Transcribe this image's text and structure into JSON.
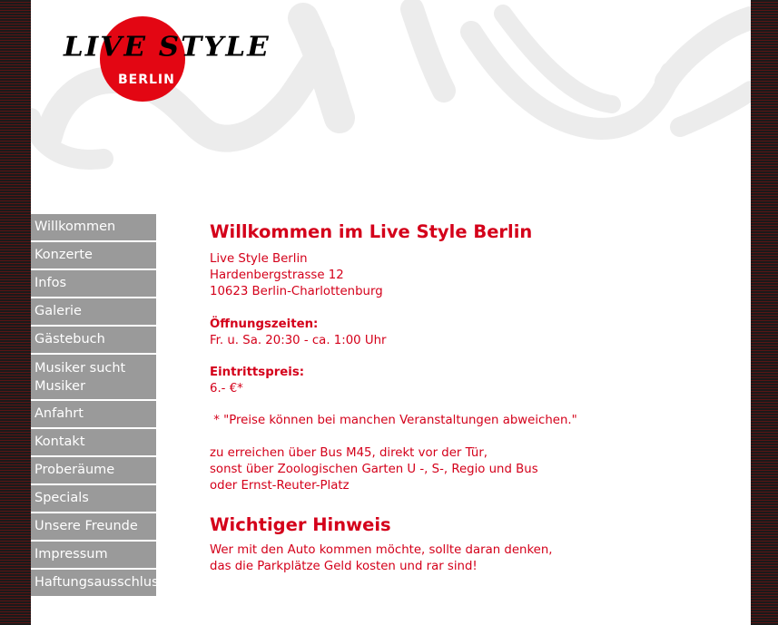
{
  "logo": {
    "wordmark": "LIVE STYLE",
    "city": "BERLIN"
  },
  "colors": {
    "accent": "#d4001a",
    "logo_circle": "#e30613",
    "nav_bg": "#9a9a9a",
    "nav_text": "#ffffff"
  },
  "nav": {
    "items": [
      {
        "label": "Willkommen"
      },
      {
        "label": "Konzerte"
      },
      {
        "label": "Infos"
      },
      {
        "label": "Galerie"
      },
      {
        "label": "Gästebuch"
      },
      {
        "label_line1": "Musiker sucht",
        "label_line2": "Musiker"
      },
      {
        "label": "Anfahrt"
      },
      {
        "label": "Kontakt"
      },
      {
        "label": "Proberäume"
      },
      {
        "label": "Specials"
      },
      {
        "label": "Unsere Freunde"
      },
      {
        "label": "Impressum"
      },
      {
        "label": "Haftungsausschluss"
      }
    ]
  },
  "main": {
    "title": "Willkommen im Live Style Berlin",
    "address": [
      "Live Style Berlin",
      "Hardenbergstrasse 12",
      "10623 Berlin-Charlottenburg"
    ],
    "hours_label": "Öffnungszeiten:",
    "hours_value": "Fr. u. Sa. 20:30 - ca. 1:00 Uhr",
    "price_label": "Eintrittspreis:",
    "price_value": "6.- €*",
    "price_note": " * \"Preise können bei manchen Veranstaltungen abweichen.\"",
    "directions": [
      "zu erreichen über Bus M45, direkt vor der Tür,",
      "sonst über Zoologischen Garten U -, S-, Regio und Bus",
      "oder Ernst-Reuter-Platz"
    ],
    "notice_title": "Wichtiger Hinweis",
    "notice_lines": [
      "Wer mit den Auto kommen möchte, sollte daran denken,",
      "das die Parkplätze Geld kosten und rar sind!"
    ]
  }
}
